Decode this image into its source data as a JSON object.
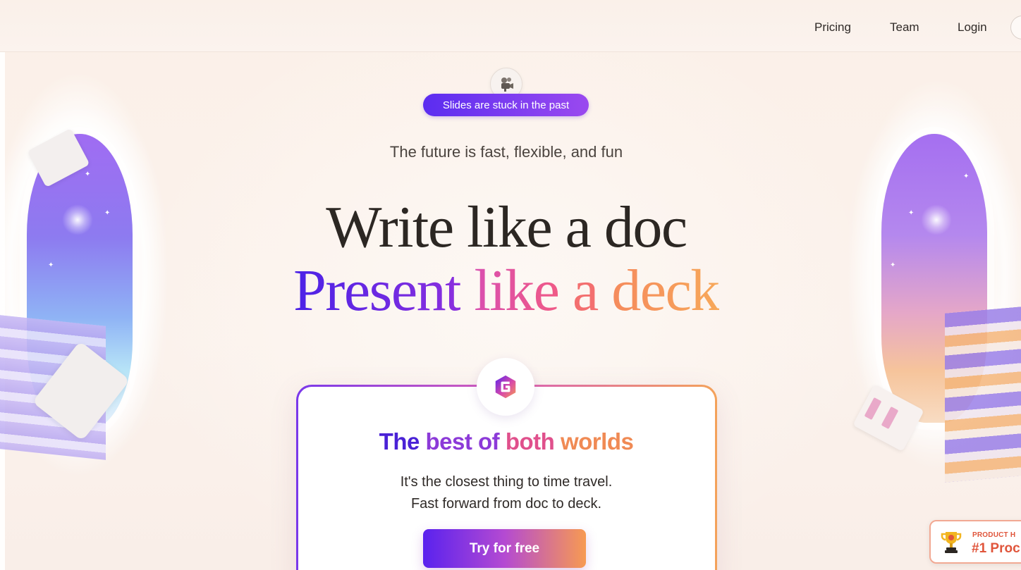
{
  "nav": {
    "links": [
      {
        "label": "Pricing"
      },
      {
        "label": "Team"
      },
      {
        "label": "Login"
      }
    ]
  },
  "hero": {
    "emoji_icon": "film-projector-icon",
    "pill_label": "Slides are stuck in the past",
    "subtitle": "The future is fast, flexible, and fun",
    "headline_line1": "Write like a doc",
    "headline_line2": {
      "part1": "Present",
      "part2": "like",
      "part3": "a",
      "part4": "deck"
    }
  },
  "card": {
    "logo_icon": "gamma-logo-icon",
    "title": {
      "w1": "The",
      "w2": "best of",
      "w3": "both",
      "w4": "worlds"
    },
    "line1": "It's the closest thing to time travel.",
    "line2": "Fast forward from doc to deck.",
    "cta_label": "Try for free"
  },
  "badge": {
    "top": "PRODUCT H",
    "main": "#1 Proc"
  },
  "colors": {
    "accent_purple": "#5b2cf0",
    "accent_pink": "#e0508c",
    "accent_orange": "#f4a25a",
    "badge_red": "#e0553b"
  }
}
